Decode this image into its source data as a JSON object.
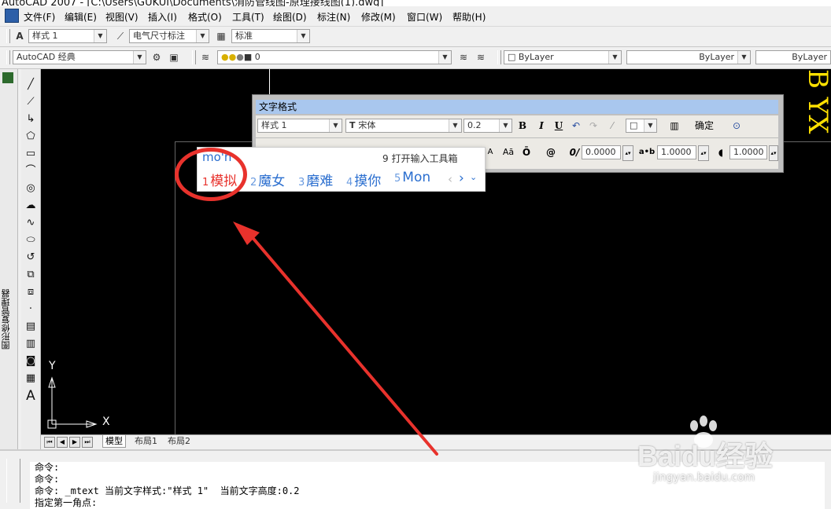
{
  "window": {
    "title": "AutoCAD 2007 - [C:\\Users\\GUKUI\\Documents\\消防管线图-原理接线图(1).dwg]"
  },
  "menu": {
    "items": [
      "文件(F)",
      "编辑(E)",
      "视图(V)",
      "插入(I)",
      "格式(O)",
      "工具(T)",
      "绘图(D)",
      "标注(N)",
      "修改(M)",
      "窗口(W)",
      "帮助(H)"
    ]
  },
  "toolbar1": {
    "text_style": "样式 1",
    "dim_style": "电气尺寸标注",
    "table_style": "标准"
  },
  "toolbar2": {
    "workspace": "AutoCAD 经典",
    "layer_value": "0",
    "color": "ByLayer",
    "linetype": "ByLayer",
    "lineweight": "ByLayer"
  },
  "side_panel": {
    "label": "图形修复管理器"
  },
  "text_format": {
    "title": "文字格式",
    "style": "样式 1",
    "font": "宋体",
    "height": "0.2",
    "bold": "B",
    "italic": "I",
    "underline": "U",
    "ok": "确定",
    "oblique": "0.0000",
    "tracking": "1.0000",
    "width": "1.0000"
  },
  "ime": {
    "pinyin": "mo'n",
    "open_toolbox": "9 打开输入工具箱",
    "candidates": [
      {
        "n": "1",
        "text": "模拟"
      },
      {
        "n": "2",
        "text": "魔女"
      },
      {
        "n": "3",
        "text": "磨难"
      },
      {
        "n": "4",
        "text": "摸你"
      },
      {
        "n": "5",
        "text": "Mon"
      }
    ]
  },
  "drawing": {
    "axis_y": "Y",
    "axis_x": "X",
    "yellow_text": "B YX"
  },
  "tabs": {
    "model": "模型",
    "layout1": "布局1",
    "layout2": "布局2"
  },
  "command": {
    "lines": [
      "命令:",
      "命令:",
      "命令: _mtext 当前文字样式:\"样式 1\"  当前文字高度:0.2",
      "指定第一角点:"
    ]
  },
  "watermark": {
    "brand": "Baidu经验",
    "url": "jingyan.baidu.com"
  },
  "colors": {
    "accent": "#2a6ecf",
    "highlight": "#e8322c",
    "titlebar": "#a9c7ee",
    "yellow": "#ffe100"
  }
}
